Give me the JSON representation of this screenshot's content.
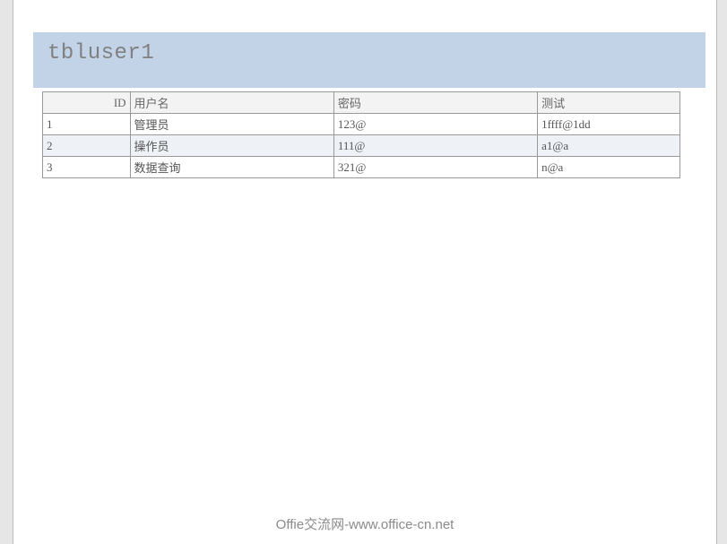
{
  "title": "tbluser1",
  "columns": {
    "id": "ID",
    "username": "用户名",
    "password": "密码",
    "test": "测试"
  },
  "rows": [
    {
      "id": "1",
      "username": "管理员",
      "password": "123@",
      "test": "1ffff@1dd"
    },
    {
      "id": "2",
      "username": "操作员",
      "password": "111@",
      "test": "a1@a"
    },
    {
      "id": "3",
      "username": "数据查询",
      "password": "321@",
      "test": "n@a"
    }
  ],
  "watermark": "Offie交流网-www.office-cn.net"
}
